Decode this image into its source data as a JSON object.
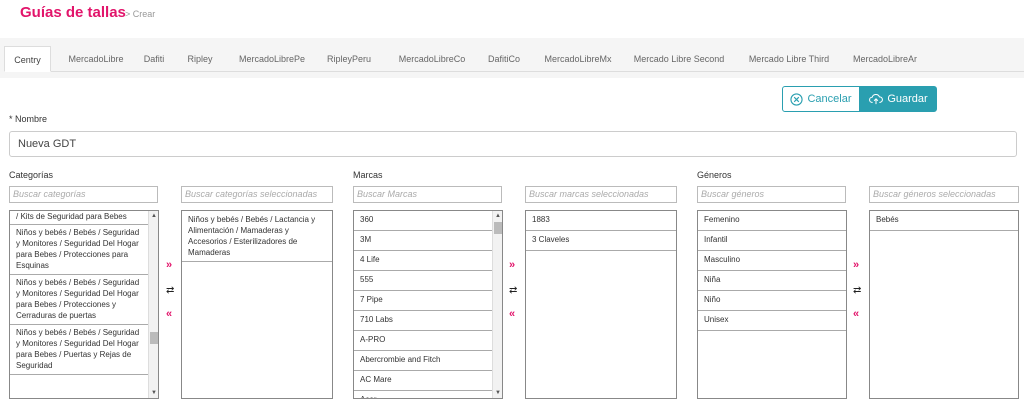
{
  "header": {
    "title": "Guías de tallas",
    "breadcrumb": "> Crear"
  },
  "tabs": [
    {
      "label": "Centry",
      "active": true
    },
    {
      "label": "MercadoLibre"
    },
    {
      "label": "Dafiti"
    },
    {
      "label": "Ripley"
    },
    {
      "label": "MercadoLibrePe"
    },
    {
      "label": "RipleyPeru"
    },
    {
      "label": "MercadoLibreCo"
    },
    {
      "label": "DafitiCo"
    },
    {
      "label": "MercadoLibreMx"
    },
    {
      "label": "Mercado Libre Second"
    },
    {
      "label": "Mercado Libre Third"
    },
    {
      "label": "MercadoLibreAr"
    }
  ],
  "actions": {
    "cancel_label": "Cancelar",
    "save_label": "Guardar",
    "accent": "#2a9fb0"
  },
  "nombre": {
    "label": "* Nombre",
    "value": "Nueva GDT"
  },
  "categorias": {
    "label": "Categorías",
    "search_placeholder": "Buscar categorías",
    "selected_placeholder": "Buscar categorías seleccionadas",
    "available": [
      "/ Kits de Seguridad para Bebes",
      "Niños y bebés / Bebés / Seguridad y Monitores / Seguridad Del Hogar para Bebes / Protecciones para Esquinas",
      "Niños y bebés / Bebés / Seguridad y Monitores / Seguridad Del Hogar para Bebes / Protecciones y Cerraduras de puertas",
      "Niños y bebés / Bebés / Seguridad y Monitores / Seguridad Del Hogar para Bebes / Puertas y Rejas de Seguridad"
    ],
    "selected": [
      "Niños y bebés / Bebés / Lactancia y Alimentación / Mamaderas y Accesorios / Esterilizadores de Mamaderas"
    ]
  },
  "marcas": {
    "label": "Marcas",
    "search_placeholder": "Buscar Marcas",
    "selected_placeholder": "Buscar marcas seleccionadas",
    "available": [
      "360",
      "3M",
      "4 Life",
      "555",
      "7 Pipe",
      "710 Labs",
      "A-PRO",
      "Abercrombie and Fitch",
      "AC Mare",
      "Acer"
    ],
    "selected": [
      "1883",
      "3 Claveles"
    ]
  },
  "generos": {
    "label": "Géneros",
    "search_placeholder": "Buscar géneros",
    "selected_placeholder": "Buscar géneros seleccionadas",
    "available": [
      "Femenino",
      "Infantil",
      "Masculino",
      "Niña",
      "Niño",
      "Unisex"
    ],
    "selected": [
      "Bebés"
    ]
  },
  "transfer": {
    "add": "»",
    "swap": "⇄",
    "remove": "«"
  },
  "colors": {
    "brand": "#e2156b"
  }
}
